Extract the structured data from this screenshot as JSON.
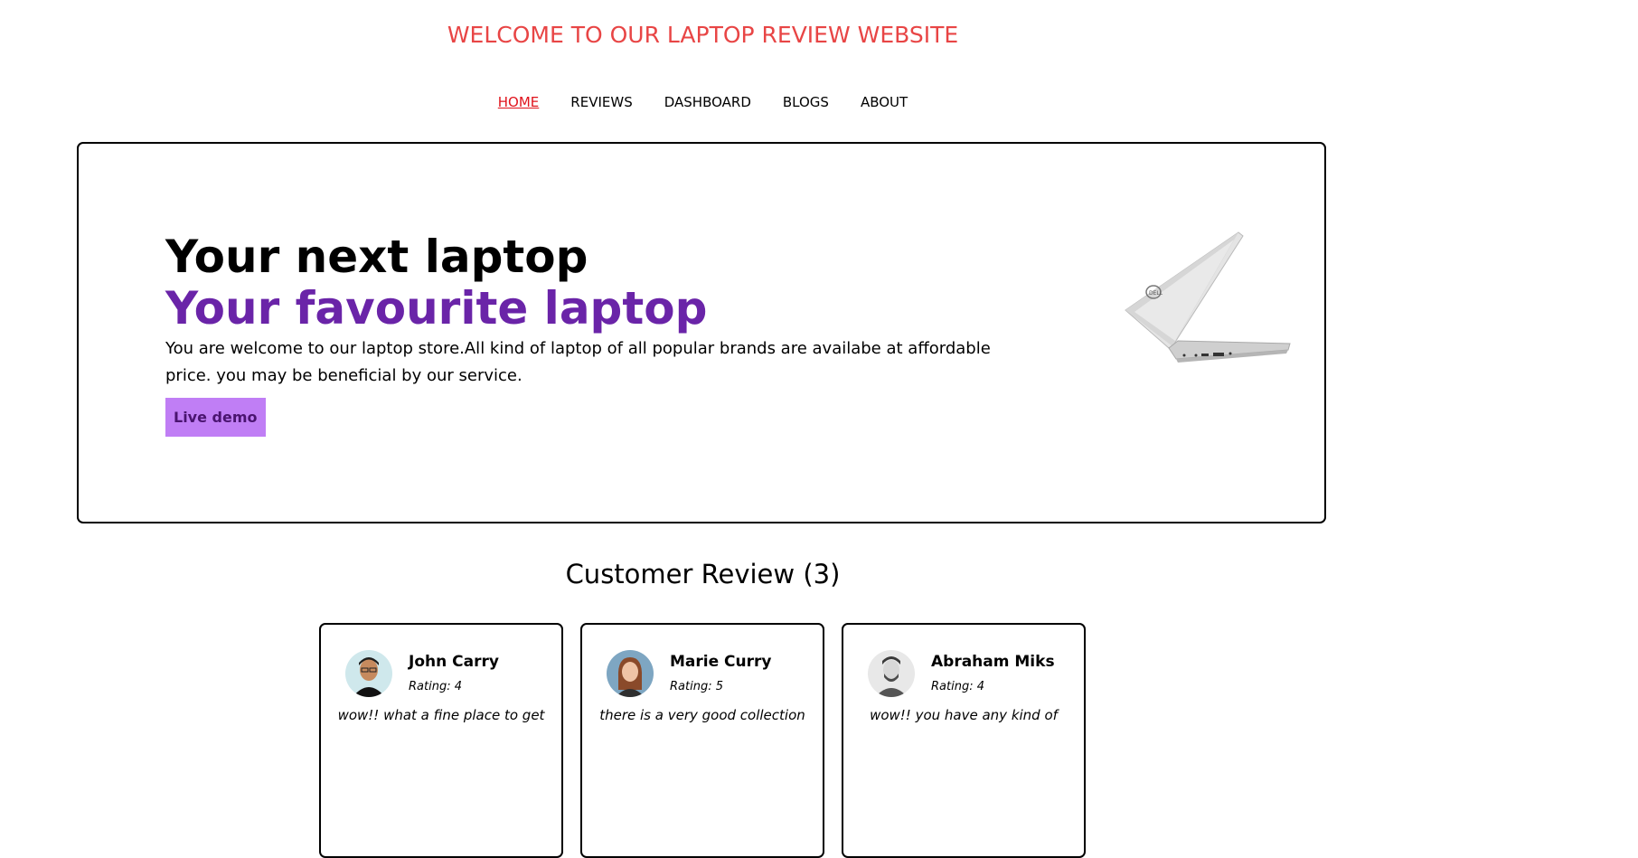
{
  "header": {
    "title": "WELCOME TO OUR LAPTOP REVIEW WEBSITE"
  },
  "nav": {
    "items": [
      {
        "label": "HOME",
        "active": true
      },
      {
        "label": "REVIEWS",
        "active": false
      },
      {
        "label": "DASHBOARD",
        "active": false
      },
      {
        "label": "BLOGS",
        "active": false
      },
      {
        "label": "ABOUT",
        "active": false
      }
    ]
  },
  "hero": {
    "line1": "Your next laptop",
    "line2": "Your favourite laptop",
    "description": "You are welcome to our laptop store.All kind of laptop of all popular brands are availabe at affordable price. you may be beneficial by our service.",
    "button_label": "Live demo",
    "image_icon": "laptop-image"
  },
  "reviews": {
    "heading": "Customer Review (3)",
    "items": [
      {
        "name": "John Carry",
        "rating": "Rating: 4",
        "text": "wow!! what a fine place to get"
      },
      {
        "name": "Marie Curry",
        "rating": "Rating: 5",
        "text": "there is a very good collection"
      },
      {
        "name": "Abraham Miks",
        "rating": "Rating: 4",
        "text": "wow!! you have any kind of"
      }
    ]
  },
  "colors": {
    "title": "#e84545",
    "nav_active": "#e0131c",
    "accent_purple": "#6a24a8",
    "button_bg": "#c07ef5"
  }
}
